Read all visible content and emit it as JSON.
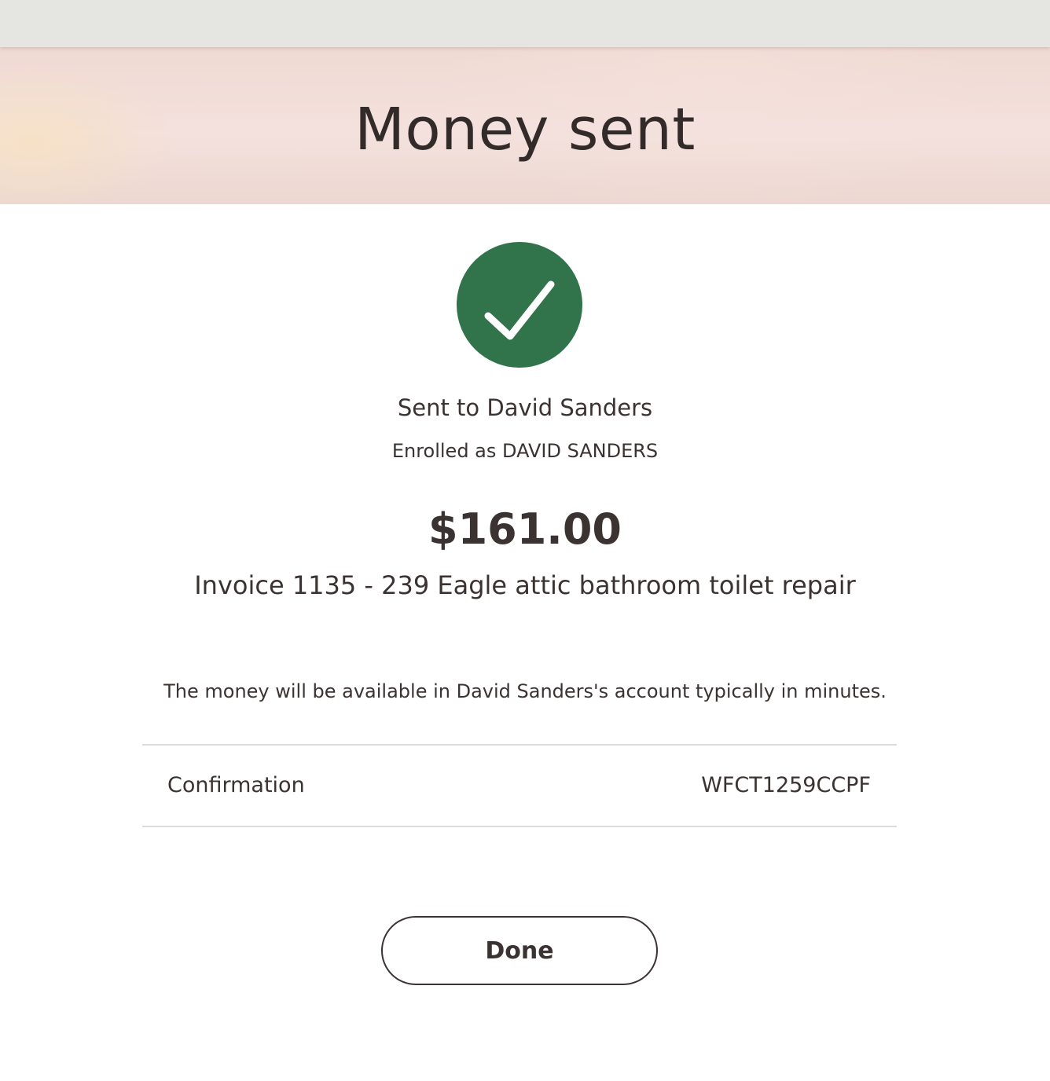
{
  "header": {
    "title": "Money sent"
  },
  "status": {
    "icon": "checkmark-circle-icon",
    "color": "#31734a"
  },
  "recipient": {
    "sent_to": "Sent to David Sanders",
    "enrolled_as": "Enrolled as DAVID SANDERS"
  },
  "payment": {
    "amount": "$161.00",
    "memo": "Invoice 1135 - 239 Eagle attic bathroom toilet repair",
    "availability_note": "The money will be available in David Sanders's account typically in minutes."
  },
  "confirmation": {
    "label": "Confirmation",
    "value": "WFCT1259CCPF"
  },
  "actions": {
    "done_label": "Done"
  }
}
